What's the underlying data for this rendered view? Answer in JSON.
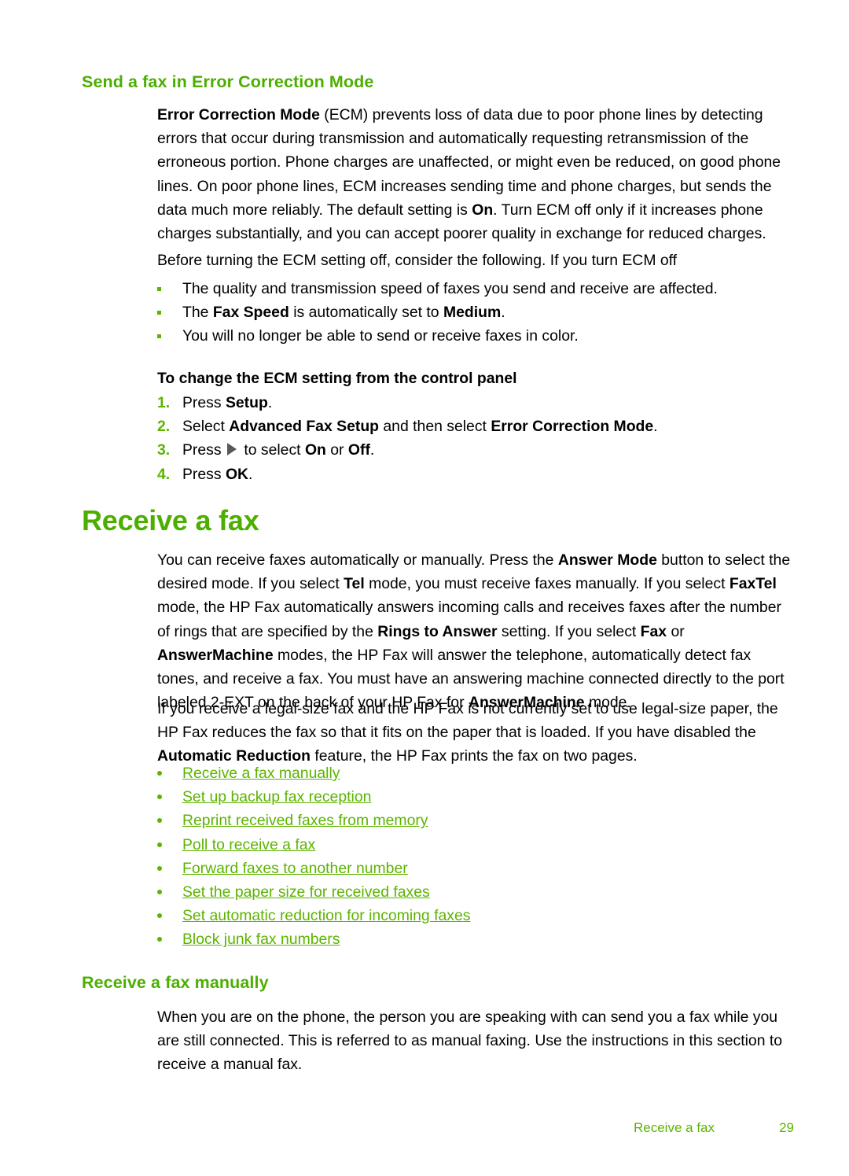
{
  "document": {
    "page_number": "29",
    "accent_color": "#4CAF00",
    "link_color": "#5CB400",
    "body_color": "#000000"
  },
  "section_ecm": {
    "heading": "Send a fax in Error Correction Mode",
    "paragraph_1_prefix_bold": "Error Correction Mode",
    "paragraph_1_part_a": " (ECM) prevents loss of data due to poor phone lines by detecting errors that occur during transmission and automatically requesting retransmission of the erroneous portion. Phone charges are unaffected, or might even be reduced, on good phone lines. On poor phone lines, ECM increases sending time and phone charges, but sends the data much more reliably. The default setting is ",
    "paragraph_1_bold_on": "On",
    "paragraph_1_part_b": ". Turn ECM off only if it increases phone charges substantially, and you can accept poorer quality in exchange for reduced charges.",
    "paragraph_2": "Before turning the ECM setting off, consider the following. If you turn ECM off",
    "bullets": [
      {
        "text_a": "The quality and transmission speed of faxes you send and receive are affected.",
        "bold_1": "",
        "text_b": "",
        "bold_2": "",
        "text_c": ""
      },
      {
        "text_a": "The ",
        "bold_1": "Fax Speed",
        "text_b": " is automatically set to ",
        "bold_2": "Medium",
        "text_c": "."
      },
      {
        "text_a": "You will no longer be able to send or receive faxes in color.",
        "bold_1": "",
        "text_b": "",
        "bold_2": "",
        "text_c": ""
      }
    ],
    "procedure_title": "To change the ECM setting from the control panel",
    "steps": [
      {
        "number": "1.",
        "text_a": "Press ",
        "bold_1": "Setup",
        "text_b": ".",
        "bold_2": "",
        "text_c": "",
        "has_arrow": false
      },
      {
        "number": "2.",
        "text_a": "Select ",
        "bold_1": "Advanced Fax Setup",
        "text_b": " and then select ",
        "bold_2": "Error Correction Mode",
        "text_c": ".",
        "has_arrow": false
      },
      {
        "number": "3.",
        "text_a": "Press ",
        "bold_1": "On",
        "text_b": " or ",
        "bold_2": "Off",
        "text_c": ".",
        "arrow_lead": " to select ",
        "has_arrow": true
      },
      {
        "number": "4.",
        "text_a": "Press ",
        "bold_1": "OK",
        "text_b": ".",
        "bold_2": "",
        "text_c": "",
        "has_arrow": false
      }
    ]
  },
  "section_receive": {
    "heading": "Receive a fax",
    "paragraph_1": {
      "t1": "You can receive faxes automatically or manually. Press the ",
      "b1": "Answer Mode",
      "t2": " button to select the desired mode. If you select ",
      "b2": "Tel",
      "t3": " mode, you must receive faxes manually. If you select ",
      "b3": "FaxTel",
      "t4": " mode, the HP Fax automatically answers incoming calls and receives faxes after the number of rings that are specified by the ",
      "b4": "Rings to Answer",
      "t5": " setting. If you select ",
      "b5": "Fax",
      "t6": " or ",
      "b6": "AnswerMachine",
      "t7": " modes, the HP Fax will answer the telephone, automatically detect fax tones, and receive a fax. You must have an answering machine connected directly to the port labeled 2-EXT on the back of your HP Fax for ",
      "b7": "AnswerMachine",
      "t8": " mode."
    },
    "paragraph_2": {
      "t1": "If you receive a legal-size fax and the HP Fax is not currently set to use legal-size paper, the HP Fax reduces the fax so that it fits on the paper that is loaded. If you have disabled the ",
      "b1": "Automatic Reduction",
      "t2": " feature, the HP Fax prints the fax on two pages."
    },
    "links": [
      "Receive a fax manually",
      "Set up backup fax reception",
      "Reprint received faxes from memory",
      "Poll to receive a fax",
      "Forward faxes to another number",
      "Set the paper size for received faxes",
      "Set automatic reduction for incoming faxes",
      "Block junk fax numbers"
    ]
  },
  "section_manual": {
    "heading": "Receive a fax manually",
    "paragraph": "When you are on the phone, the person you are speaking with can send you a fax while you are still connected. This is referred to as manual faxing. Use the instructions in this section to receive a manual fax."
  },
  "footer": {
    "title": "Receive a fax",
    "page": "29"
  }
}
